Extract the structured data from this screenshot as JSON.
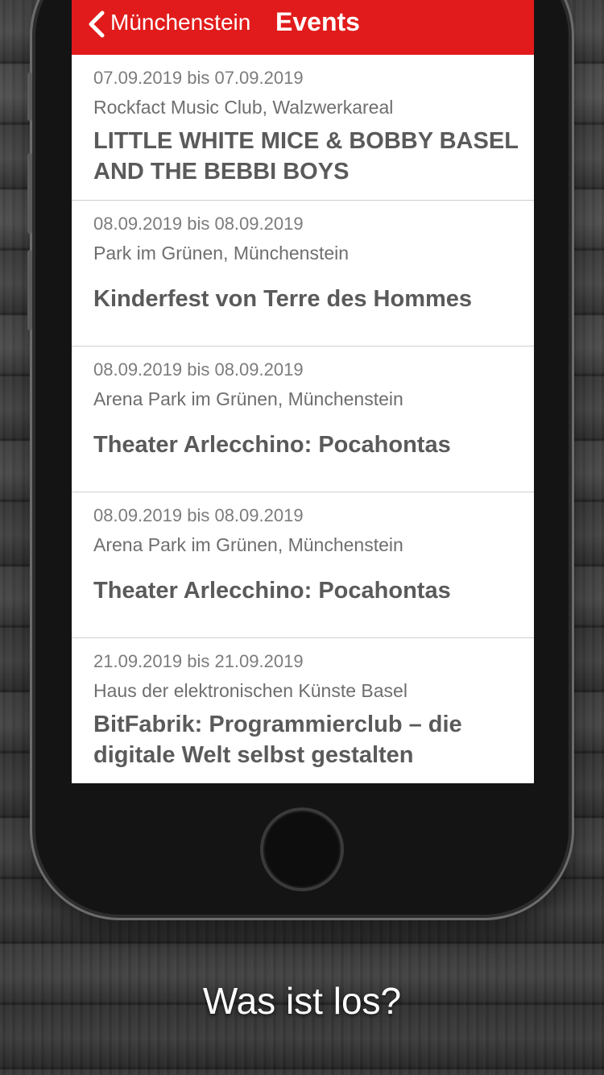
{
  "nav": {
    "back_label": "Münchenstein",
    "title": "Events"
  },
  "events": [
    {
      "date": "07.09.2019 bis 07.09.2019",
      "venue": "Rockfact Music Club, Walzwerkareal",
      "title": "LITTLE WHITE MICE & BOBBY BASEL AND THE BEBBI BOYS"
    },
    {
      "date": "08.09.2019 bis 08.09.2019",
      "venue": "Park im Grünen, Münchenstein",
      "title": "Kinderfest von Terre des Hommes"
    },
    {
      "date": "08.09.2019 bis 08.09.2019",
      "venue": "Arena Park im Grünen, Münchenstein",
      "title": "Theater Arlecchino: Pocahontas"
    },
    {
      "date": "08.09.2019 bis 08.09.2019",
      "venue": "Arena Park im Grünen, Münchenstein",
      "title": "Theater Arlecchino: Pocahontas"
    },
    {
      "date": "21.09.2019 bis 21.09.2019",
      "venue": "Haus der elektronischen Künste Basel",
      "title": "BitFabrik: Programmierclub – die digitale Welt selbst gestalten"
    }
  ],
  "tagline": "Was ist los?",
  "colors": {
    "accent": "#e11b1b",
    "text": "#5a5a5a"
  }
}
